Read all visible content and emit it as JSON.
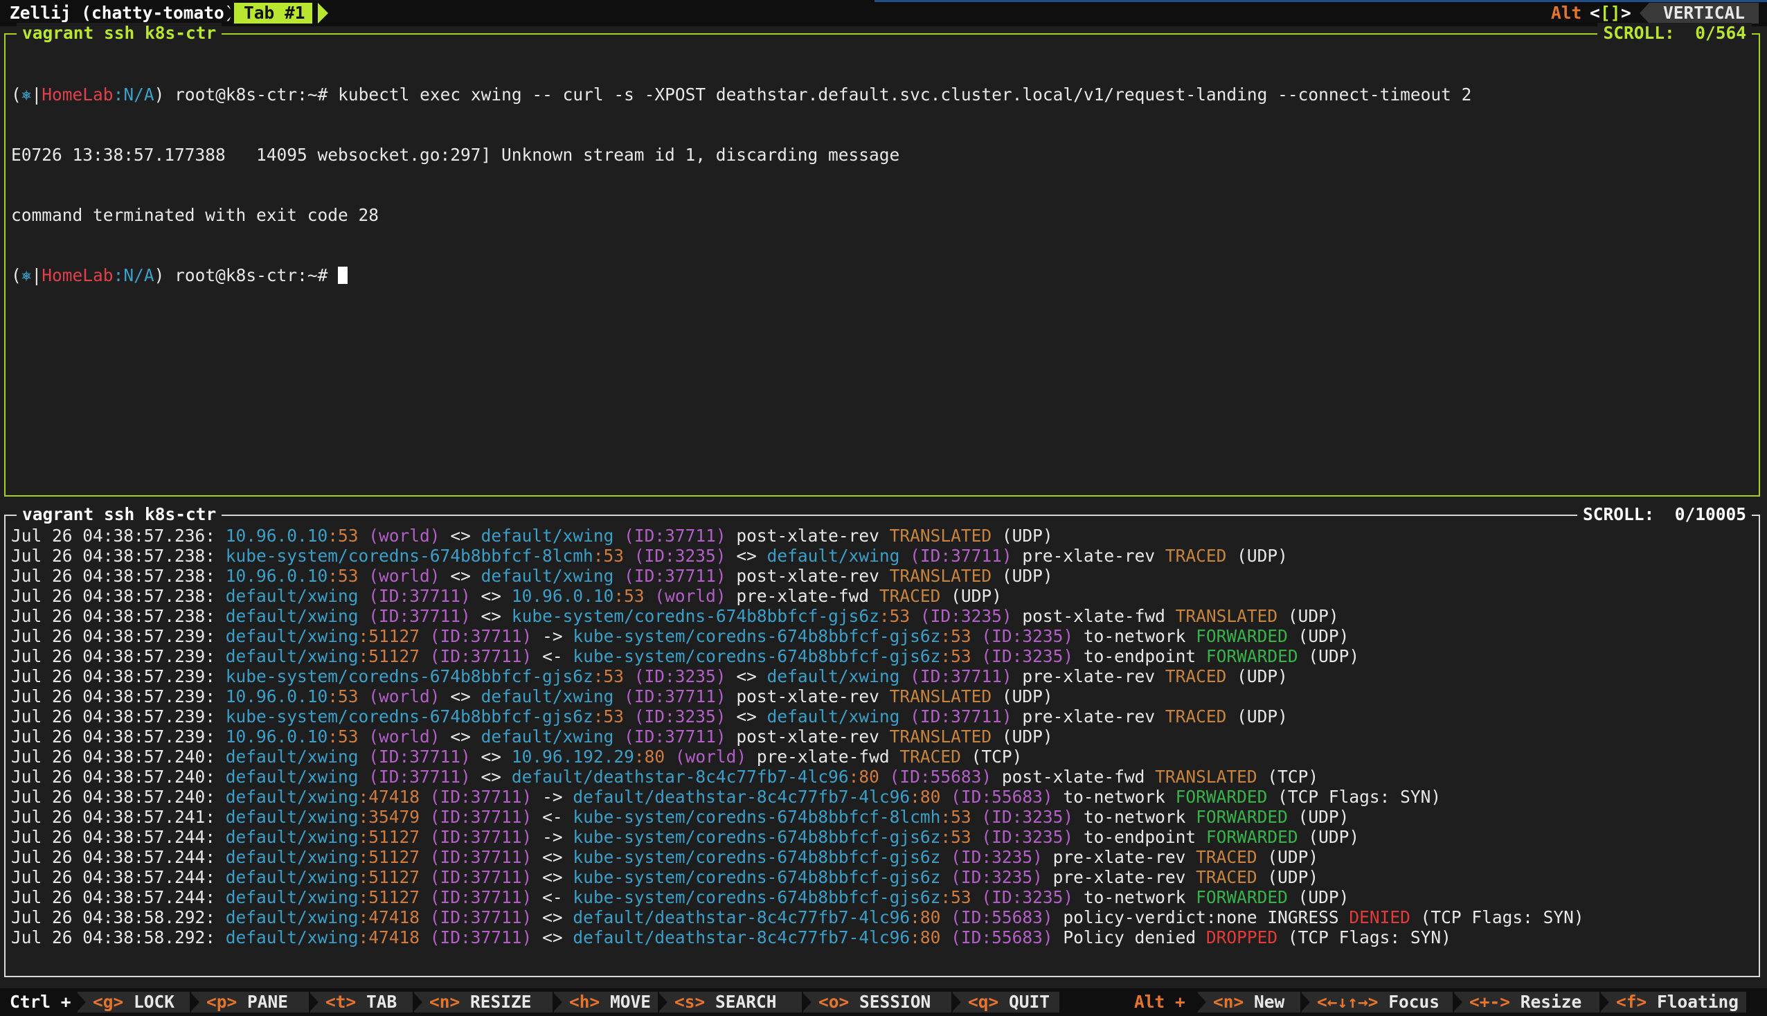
{
  "topbar": {
    "app_title": "Zellij (chatty-tomato)",
    "tab_label": "Tab #1",
    "alt_label": "Alt",
    "bracket_open": "<",
    "bracket_glyph": "[]",
    "bracket_close": ">",
    "layout_label": "VERTICAL"
  },
  "pane_top": {
    "title": "vagrant ssh k8s-ctr",
    "scroll": "SCROLL:  0/564",
    "prompt_prefix": "(",
    "prompt_icon": "⎈",
    "prompt_bar": "|",
    "prompt_cluster": "HomeLab",
    "prompt_ns": ":N/A",
    "prompt_suffix": ") root@k8s-ctr:~# ",
    "command": "kubectl exec xwing -- curl -s -XPOST deathstar.default.svc.cluster.local/v1/request-landing --connect-timeout 2",
    "output1": "E0726 13:38:57.177388   14095 websocket.go:297] Unknown stream id 1, discarding message",
    "output2": "command terminated with exit code 28"
  },
  "pane_bottom": {
    "title": "vagrant ssh k8s-ctr",
    "scroll": "SCROLL:  0/10005",
    "lines": [
      [
        [
          "Jul 26 04:38:57.236: ",
          "t"
        ],
        [
          "10.96.0.10",
          "ip"
        ],
        [
          ":53",
          "port"
        ],
        [
          " (world)",
          "world"
        ],
        [
          " <> ",
          "t"
        ],
        [
          "default/xwing",
          "ip"
        ],
        [
          " (ID:37711)",
          "id"
        ],
        [
          " post-xlate-rev ",
          "t"
        ],
        [
          "TRANSLATED",
          "trans"
        ],
        [
          " (UDP)",
          "t"
        ]
      ],
      [
        [
          "Jul 26 04:38:57.238: ",
          "t"
        ],
        [
          "kube-system/coredns-674b8bbfcf-8lcmh",
          "ip"
        ],
        [
          ":53",
          "port"
        ],
        [
          " (ID:3235)",
          "id"
        ],
        [
          " <> ",
          "t"
        ],
        [
          "default/xwing",
          "ip"
        ],
        [
          " (ID:37711)",
          "id"
        ],
        [
          " pre-xlate-rev ",
          "t"
        ],
        [
          "TRACED",
          "trans"
        ],
        [
          " (UDP)",
          "t"
        ]
      ],
      [
        [
          "Jul 26 04:38:57.238: ",
          "t"
        ],
        [
          "10.96.0.10",
          "ip"
        ],
        [
          ":53",
          "port"
        ],
        [
          " (world)",
          "world"
        ],
        [
          " <> ",
          "t"
        ],
        [
          "default/xwing",
          "ip"
        ],
        [
          " (ID:37711)",
          "id"
        ],
        [
          " post-xlate-rev ",
          "t"
        ],
        [
          "TRANSLATED",
          "trans"
        ],
        [
          " (UDP)",
          "t"
        ]
      ],
      [
        [
          "Jul 26 04:38:57.238: ",
          "t"
        ],
        [
          "default/xwing",
          "ip"
        ],
        [
          " (ID:37711)",
          "id"
        ],
        [
          " <> ",
          "t"
        ],
        [
          "10.96.0.10",
          "ip"
        ],
        [
          ":53",
          "port"
        ],
        [
          " (world)",
          "world"
        ],
        [
          " pre-xlate-fwd ",
          "t"
        ],
        [
          "TRACED",
          "trans"
        ],
        [
          " (UDP)",
          "t"
        ]
      ],
      [
        [
          "Jul 26 04:38:57.238: ",
          "t"
        ],
        [
          "default/xwing",
          "ip"
        ],
        [
          " (ID:37711)",
          "id"
        ],
        [
          " <> ",
          "t"
        ],
        [
          "kube-system/coredns-674b8bbfcf-gjs6z",
          "ip"
        ],
        [
          ":53",
          "port"
        ],
        [
          " (ID:3235)",
          "id"
        ],
        [
          " post-xlate-fwd ",
          "t"
        ],
        [
          "TRANSLATED",
          "trans"
        ],
        [
          " (UDP)",
          "t"
        ]
      ],
      [
        [
          "Jul 26 04:38:57.239: ",
          "t"
        ],
        [
          "default/xwing",
          "ip"
        ],
        [
          ":51127",
          "port"
        ],
        [
          " (ID:37711)",
          "id"
        ],
        [
          " -> ",
          "t"
        ],
        [
          "kube-system/coredns-674b8bbfcf-gjs6z",
          "ip"
        ],
        [
          ":53",
          "port"
        ],
        [
          " (ID:3235)",
          "id"
        ],
        [
          " to-network ",
          "t"
        ],
        [
          "FORWARDED",
          "fwd"
        ],
        [
          " (UDP)",
          "t"
        ]
      ],
      [
        [
          "Jul 26 04:38:57.239: ",
          "t"
        ],
        [
          "default/xwing",
          "ip"
        ],
        [
          ":51127",
          "port"
        ],
        [
          " (ID:37711)",
          "id"
        ],
        [
          " <- ",
          "t"
        ],
        [
          "kube-system/coredns-674b8bbfcf-gjs6z",
          "ip"
        ],
        [
          ":53",
          "port"
        ],
        [
          " (ID:3235)",
          "id"
        ],
        [
          " to-endpoint ",
          "t"
        ],
        [
          "FORWARDED",
          "fwd"
        ],
        [
          " (UDP)",
          "t"
        ]
      ],
      [
        [
          "Jul 26 04:38:57.239: ",
          "t"
        ],
        [
          "kube-system/coredns-674b8bbfcf-gjs6z",
          "ip"
        ],
        [
          ":53",
          "port"
        ],
        [
          " (ID:3235)",
          "id"
        ],
        [
          " <> ",
          "t"
        ],
        [
          "default/xwing",
          "ip"
        ],
        [
          " (ID:37711)",
          "id"
        ],
        [
          " pre-xlate-rev ",
          "t"
        ],
        [
          "TRACED",
          "trans"
        ],
        [
          " (UDP)",
          "t"
        ]
      ],
      [
        [
          "Jul 26 04:38:57.239: ",
          "t"
        ],
        [
          "10.96.0.10",
          "ip"
        ],
        [
          ":53",
          "port"
        ],
        [
          " (world)",
          "world"
        ],
        [
          " <> ",
          "t"
        ],
        [
          "default/xwing",
          "ip"
        ],
        [
          " (ID:37711)",
          "id"
        ],
        [
          " post-xlate-rev ",
          "t"
        ],
        [
          "TRANSLATED",
          "trans"
        ],
        [
          " (UDP)",
          "t"
        ]
      ],
      [
        [
          "Jul 26 04:38:57.239: ",
          "t"
        ],
        [
          "kube-system/coredns-674b8bbfcf-gjs6z",
          "ip"
        ],
        [
          ":53",
          "port"
        ],
        [
          " (ID:3235)",
          "id"
        ],
        [
          " <> ",
          "t"
        ],
        [
          "default/xwing",
          "ip"
        ],
        [
          " (ID:37711)",
          "id"
        ],
        [
          " pre-xlate-rev ",
          "t"
        ],
        [
          "TRACED",
          "trans"
        ],
        [
          " (UDP)",
          "t"
        ]
      ],
      [
        [
          "Jul 26 04:38:57.239: ",
          "t"
        ],
        [
          "10.96.0.10",
          "ip"
        ],
        [
          ":53",
          "port"
        ],
        [
          " (world)",
          "world"
        ],
        [
          " <> ",
          "t"
        ],
        [
          "default/xwing",
          "ip"
        ],
        [
          " (ID:37711)",
          "id"
        ],
        [
          " post-xlate-rev ",
          "t"
        ],
        [
          "TRANSLATED",
          "trans"
        ],
        [
          " (UDP)",
          "t"
        ]
      ],
      [
        [
          "Jul 26 04:38:57.240: ",
          "t"
        ],
        [
          "default/xwing",
          "ip"
        ],
        [
          " (ID:37711)",
          "id"
        ],
        [
          " <> ",
          "t"
        ],
        [
          "10.96.192.29",
          "ip"
        ],
        [
          ":80",
          "port"
        ],
        [
          " (world)",
          "world"
        ],
        [
          " pre-xlate-fwd ",
          "t"
        ],
        [
          "TRACED",
          "trans"
        ],
        [
          " (TCP)",
          "t"
        ]
      ],
      [
        [
          "Jul 26 04:38:57.240: ",
          "t"
        ],
        [
          "default/xwing",
          "ip"
        ],
        [
          " (ID:37711)",
          "id"
        ],
        [
          " <> ",
          "t"
        ],
        [
          "default/deathstar-8c4c77fb7-4lc96",
          "ip"
        ],
        [
          ":80",
          "port"
        ],
        [
          " (ID:55683)",
          "id"
        ],
        [
          " post-xlate-fwd ",
          "t"
        ],
        [
          "TRANSLATED",
          "trans"
        ],
        [
          " (TCP)",
          "t"
        ]
      ],
      [
        [
          "Jul 26 04:38:57.240: ",
          "t"
        ],
        [
          "default/xwing",
          "ip"
        ],
        [
          ":47418",
          "port"
        ],
        [
          " (ID:37711)",
          "id"
        ],
        [
          " -> ",
          "t"
        ],
        [
          "default/deathstar-8c4c77fb7-4lc96",
          "ip"
        ],
        [
          ":80",
          "port"
        ],
        [
          " (ID:55683)",
          "id"
        ],
        [
          " to-network ",
          "t"
        ],
        [
          "FORWARDED",
          "fwd"
        ],
        [
          " (TCP Flags: SYN)",
          "t"
        ]
      ],
      [
        [
          "Jul 26 04:38:57.241: ",
          "t"
        ],
        [
          "default/xwing",
          "ip"
        ],
        [
          ":35479",
          "port"
        ],
        [
          " (ID:37711)",
          "id"
        ],
        [
          " <- ",
          "t"
        ],
        [
          "kube-system/coredns-674b8bbfcf-8lcmh",
          "ip"
        ],
        [
          ":53",
          "port"
        ],
        [
          " (ID:3235)",
          "id"
        ],
        [
          " to-network ",
          "t"
        ],
        [
          "FORWARDED",
          "fwd"
        ],
        [
          " (UDP)",
          "t"
        ]
      ],
      [
        [
          "Jul 26 04:38:57.244: ",
          "t"
        ],
        [
          "default/xwing",
          "ip"
        ],
        [
          ":51127",
          "port"
        ],
        [
          " (ID:37711)",
          "id"
        ],
        [
          " -> ",
          "t"
        ],
        [
          "kube-system/coredns-674b8bbfcf-gjs6z",
          "ip"
        ],
        [
          ":53",
          "port"
        ],
        [
          " (ID:3235)",
          "id"
        ],
        [
          " to-endpoint ",
          "t"
        ],
        [
          "FORWARDED",
          "fwd"
        ],
        [
          " (UDP)",
          "t"
        ]
      ],
      [
        [
          "Jul 26 04:38:57.244: ",
          "t"
        ],
        [
          "default/xwing",
          "ip"
        ],
        [
          ":51127",
          "port"
        ],
        [
          " (ID:37711)",
          "id"
        ],
        [
          " <> ",
          "t"
        ],
        [
          "kube-system/coredns-674b8bbfcf-gjs6z",
          "ip"
        ],
        [
          " (ID:3235)",
          "id"
        ],
        [
          " pre-xlate-rev ",
          "t"
        ],
        [
          "TRACED",
          "trans"
        ],
        [
          " (UDP)",
          "t"
        ]
      ],
      [
        [
          "Jul 26 04:38:57.244: ",
          "t"
        ],
        [
          "default/xwing",
          "ip"
        ],
        [
          ":51127",
          "port"
        ],
        [
          " (ID:37711)",
          "id"
        ],
        [
          " <> ",
          "t"
        ],
        [
          "kube-system/coredns-674b8bbfcf-gjs6z",
          "ip"
        ],
        [
          " (ID:3235)",
          "id"
        ],
        [
          " pre-xlate-rev ",
          "t"
        ],
        [
          "TRACED",
          "trans"
        ],
        [
          " (UDP)",
          "t"
        ]
      ],
      [
        [
          "Jul 26 04:38:57.244: ",
          "t"
        ],
        [
          "default/xwing",
          "ip"
        ],
        [
          ":51127",
          "port"
        ],
        [
          " (ID:37711)",
          "id"
        ],
        [
          " <- ",
          "t"
        ],
        [
          "kube-system/coredns-674b8bbfcf-gjs6z",
          "ip"
        ],
        [
          ":53",
          "port"
        ],
        [
          " (ID:3235)",
          "id"
        ],
        [
          " to-network ",
          "t"
        ],
        [
          "FORWARDED",
          "fwd"
        ],
        [
          " (UDP)",
          "t"
        ]
      ],
      [
        [
          "Jul 26 04:38:58.292: ",
          "t"
        ],
        [
          "default/xwing",
          "ip"
        ],
        [
          ":47418",
          "port"
        ],
        [
          " (ID:37711)",
          "id"
        ],
        [
          " <> ",
          "t"
        ],
        [
          "default/deathstar-8c4c77fb7-4lc96",
          "ip"
        ],
        [
          ":80",
          "port"
        ],
        [
          " (ID:55683)",
          "id"
        ],
        [
          " policy-verdict:none INGRESS ",
          "t"
        ],
        [
          "DENIED",
          "den"
        ],
        [
          " (TCP Flags: SYN)",
          "t"
        ]
      ],
      [
        [
          "Jul 26 04:38:58.292: ",
          "t"
        ],
        [
          "default/xwing",
          "ip"
        ],
        [
          ":47418",
          "port"
        ],
        [
          " (ID:37711)",
          "id"
        ],
        [
          " <> ",
          "t"
        ],
        [
          "default/deathstar-8c4c77fb7-4lc96",
          "ip"
        ],
        [
          ":80",
          "port"
        ],
        [
          " (ID:55683)",
          "id"
        ],
        [
          " Policy denied ",
          "t"
        ],
        [
          "DROPPED",
          "den"
        ],
        [
          " (TCP Flags: SYN)",
          "t"
        ]
      ]
    ]
  },
  "bottombar": {
    "ctrl_label": "Ctrl +",
    "keys": [
      {
        "key": "<g>",
        "label": " LOCK"
      },
      {
        "key": "<p>",
        "label": " PANE"
      },
      {
        "key": "<t>",
        "label": " TAB"
      },
      {
        "key": "<n>",
        "label": " RESIZE"
      },
      {
        "key": "<h>",
        "label": " MOVE"
      },
      {
        "key": "<s>",
        "label": " SEARCH"
      },
      {
        "key": "<o>",
        "label": " SESSION"
      },
      {
        "key": "<q>",
        "label": " QUIT"
      }
    ],
    "alt_label": "Alt +",
    "alt_keys": [
      {
        "key": "<n>",
        "label": " New"
      },
      {
        "key": "<←↓↑→>",
        "label": " Focus"
      },
      {
        "key": "<+->",
        "label": " Resize"
      },
      {
        "key": "<f>",
        "label": " Floating"
      }
    ]
  },
  "colors": {
    "accent_green": "#b9e62e",
    "hint_orange": "#e5752d",
    "ip_cyan": "#3aa0c9",
    "id_purple": "#b45fc8",
    "forwarded_green": "#38b34a",
    "denied_red": "#e53a3a"
  }
}
